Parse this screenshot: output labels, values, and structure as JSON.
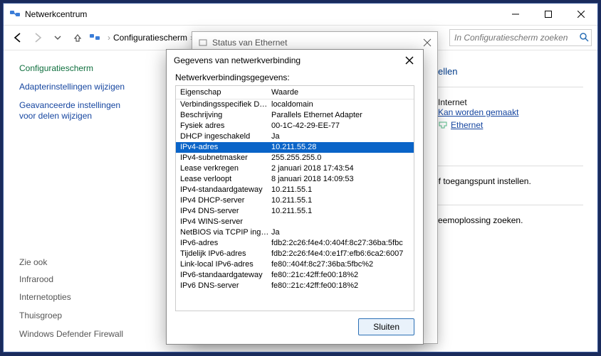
{
  "window": {
    "title": "Netwerkcentrum"
  },
  "nav": {
    "breadcrumb": "Configuratiescherm",
    "search_placeholder": "In Configuratiescherm zoeken"
  },
  "sidebar": {
    "heading": "Configuratiescherm",
    "links": [
      "Adapterinstellingen wijzigen",
      "Geavanceerde instellingen voor delen wijzigen"
    ],
    "see_also_label": "Zie ook",
    "see_also": [
      "Infrarood",
      "Internetopties",
      "Thuisgroep",
      "Windows Defender Firewall"
    ]
  },
  "right": {
    "header_suffix": "ellen",
    "internet_label": "Internet",
    "cannot_be_made": "Kan worden gemaakt",
    "ethernet": "Ethernet",
    "line1_suffix": "er of toegangspunt instellen.",
    "line2_suffix": "robleemoplossing zoeken."
  },
  "dlg_status": {
    "title": "Status van Ethernet"
  },
  "dlg_details": {
    "title": "Gegevens van netwerkverbinding",
    "subtitle": "Netwerkverbindingsgegevens:",
    "col_prop": "Eigenschap",
    "col_val": "Waarde",
    "close": "Sluiten",
    "rows": [
      {
        "p": "Verbindingsspecifiek DN...",
        "v": "localdomain"
      },
      {
        "p": "Beschrijving",
        "v": "Parallels Ethernet Adapter"
      },
      {
        "p": "Fysiek adres",
        "v": "00-1C-42-29-EE-77"
      },
      {
        "p": "DHCP ingeschakeld",
        "v": "Ja"
      },
      {
        "p": "IPv4-adres",
        "v": "10.211.55.28",
        "sel": true
      },
      {
        "p": "IPv4-subnetmasker",
        "v": "255.255.255.0"
      },
      {
        "p": "Lease verkregen",
        "v": "2 januari 2018 17:43:54"
      },
      {
        "p": "Lease verloopt",
        "v": "8 januari 2018 14:09:53"
      },
      {
        "p": "IPv4-standaardgateway",
        "v": "10.211.55.1"
      },
      {
        "p": "IPv4 DHCP-server",
        "v": "10.211.55.1"
      },
      {
        "p": "IPv4 DNS-server",
        "v": "10.211.55.1"
      },
      {
        "p": "IPv4 WINS-server",
        "v": ""
      },
      {
        "p": "NetBIOS via TCPIP inges...",
        "v": "Ja"
      },
      {
        "p": "IPv6-adres",
        "v": "fdb2:2c26:f4e4:0:404f:8c27:36ba:5fbc"
      },
      {
        "p": "Tijdelijk IPv6-adres",
        "v": "fdb2:2c26:f4e4:0:e1f7:efb6:6ca2:6007"
      },
      {
        "p": "Link-local IPv6-adres",
        "v": "fe80::404f:8c27:36ba:5fbc%2"
      },
      {
        "p": "IPv6-standaardgateway",
        "v": "fe80::21c:42ff:fe00:18%2"
      },
      {
        "p": "IPv6 DNS-server",
        "v": "fe80::21c:42ff:fe00:18%2"
      }
    ]
  }
}
